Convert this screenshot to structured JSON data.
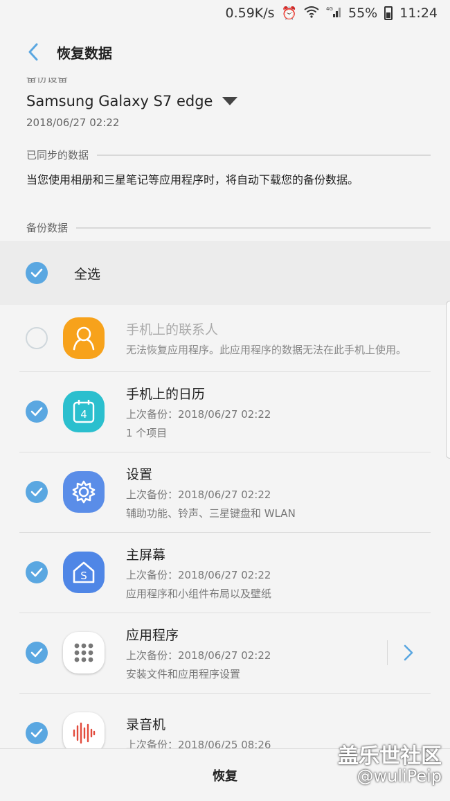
{
  "status_bar": {
    "speed": "0.59K/s",
    "network": "4G",
    "battery": "55%",
    "time": "11:24"
  },
  "header": {
    "title": "恢复数据"
  },
  "device": {
    "section_label_cut": "备份设备",
    "name": "Samsung Galaxy S7 edge",
    "date": "2018/06/27 02:22"
  },
  "synced": {
    "heading": "已同步的数据",
    "description": "当您使用相册和三星笔记等应用程序时，将自动下载您的备份数据。"
  },
  "backup": {
    "heading": "备份数据",
    "select_all": "全选",
    "items": [
      {
        "title": "手机上的联系人",
        "sub1": "无法恢复应用程序。此应用程序的数据无法在此手机上使用。",
        "sub2": "",
        "checked": false,
        "icon": "contacts-icon",
        "color": "#f7a21b"
      },
      {
        "title": "手机上的日历",
        "sub1": "上次备份：2018/06/27 02:22",
        "sub2": "1 个项目",
        "checked": true,
        "icon": "calendar-icon",
        "color": "#2bbfce",
        "calendar_day": "4"
      },
      {
        "title": "设置",
        "sub1": "上次备份：2018/06/27 02:22",
        "sub2": "辅助功能、铃声、三星键盘和 WLAN",
        "checked": true,
        "icon": "settings-gear-icon",
        "color": "#5a8de8"
      },
      {
        "title": "主屏幕",
        "sub1": "上次备份：2018/06/27 02:22",
        "sub2": "应用程序和小组件布局以及壁纸",
        "checked": true,
        "icon": "home-screen-icon",
        "color": "#4f86e6"
      },
      {
        "title": "应用程序",
        "sub1": "上次备份：2018/06/27 02:22",
        "sub2": "安装文件和应用程序设置",
        "checked": true,
        "icon": "apps-grid-icon",
        "color": "#ffffff"
      },
      {
        "title": "录音机",
        "sub1": "上次备份：2018/06/25 08:26",
        "sub2": "",
        "checked": true,
        "icon": "voice-recorder-icon",
        "color": "#ffffff"
      }
    ]
  },
  "footer": {
    "restore_label": "恢复"
  },
  "watermark": {
    "line1": "盖乐世社区",
    "line2": "@wuliPeip"
  },
  "colors": {
    "accent": "#5aa7e1",
    "background": "#f4f4f4"
  }
}
